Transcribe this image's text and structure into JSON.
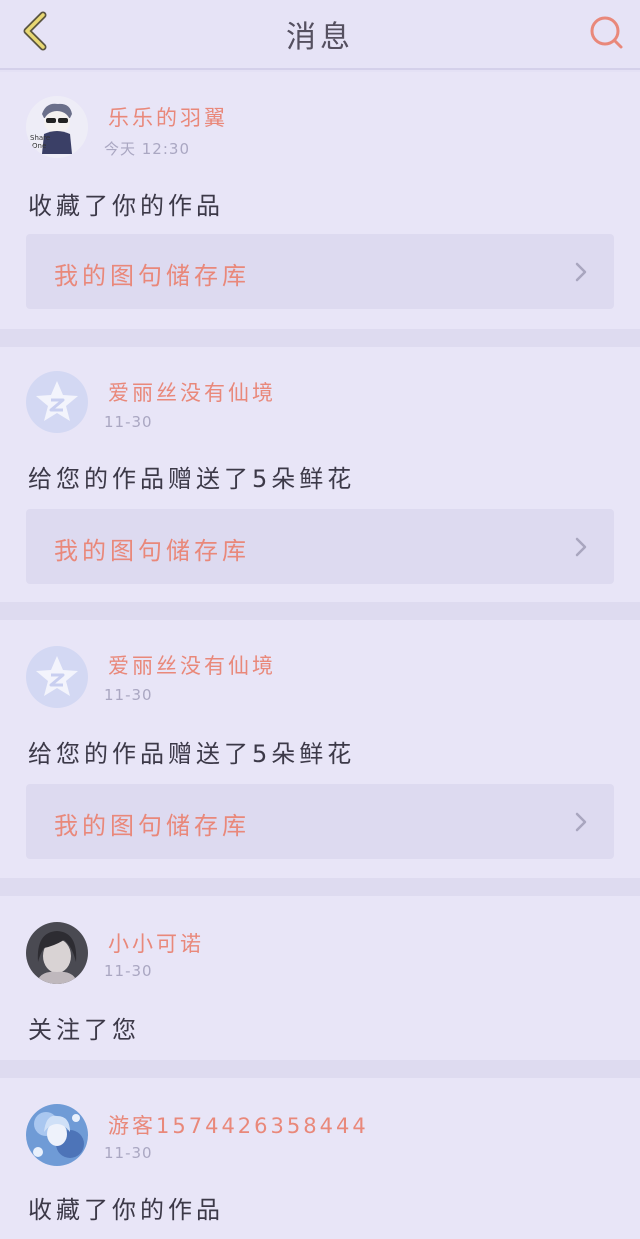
{
  "header": {
    "title": "消息",
    "back_icon": "chevron-left-icon",
    "search_icon": "search-icon"
  },
  "colors": {
    "accent": "#e9887a",
    "background": "#e4e1f5",
    "card": "#e8e5f7",
    "link_bg": "#dddaf0",
    "text": "#3c3948",
    "muted": "#aaa7c2"
  },
  "messages": [
    {
      "sender": "乐乐的羽翼",
      "time": "今天 12:30",
      "text": "收藏了你的作品",
      "link": "我的图句储存库",
      "avatar": "cartoon-boy-avatar"
    },
    {
      "sender": "爱丽丝没有仙境",
      "time": "11-30",
      "text": "给您的作品赠送了5朵鲜花",
      "link": "我的图句储存库",
      "avatar": "default-avatar"
    },
    {
      "sender": "爱丽丝没有仙境",
      "time": "11-30",
      "text": "给您的作品赠送了5朵鲜花",
      "link": "我的图句储存库",
      "avatar": "default-avatar"
    },
    {
      "sender": "小小可诺",
      "time": "11-30",
      "text": "关注了您",
      "avatar": "photo-avatar"
    },
    {
      "sender": "游客1574426358444",
      "time": "11-30",
      "text": "收藏了你的作品",
      "avatar": "anime-avatar"
    }
  ]
}
